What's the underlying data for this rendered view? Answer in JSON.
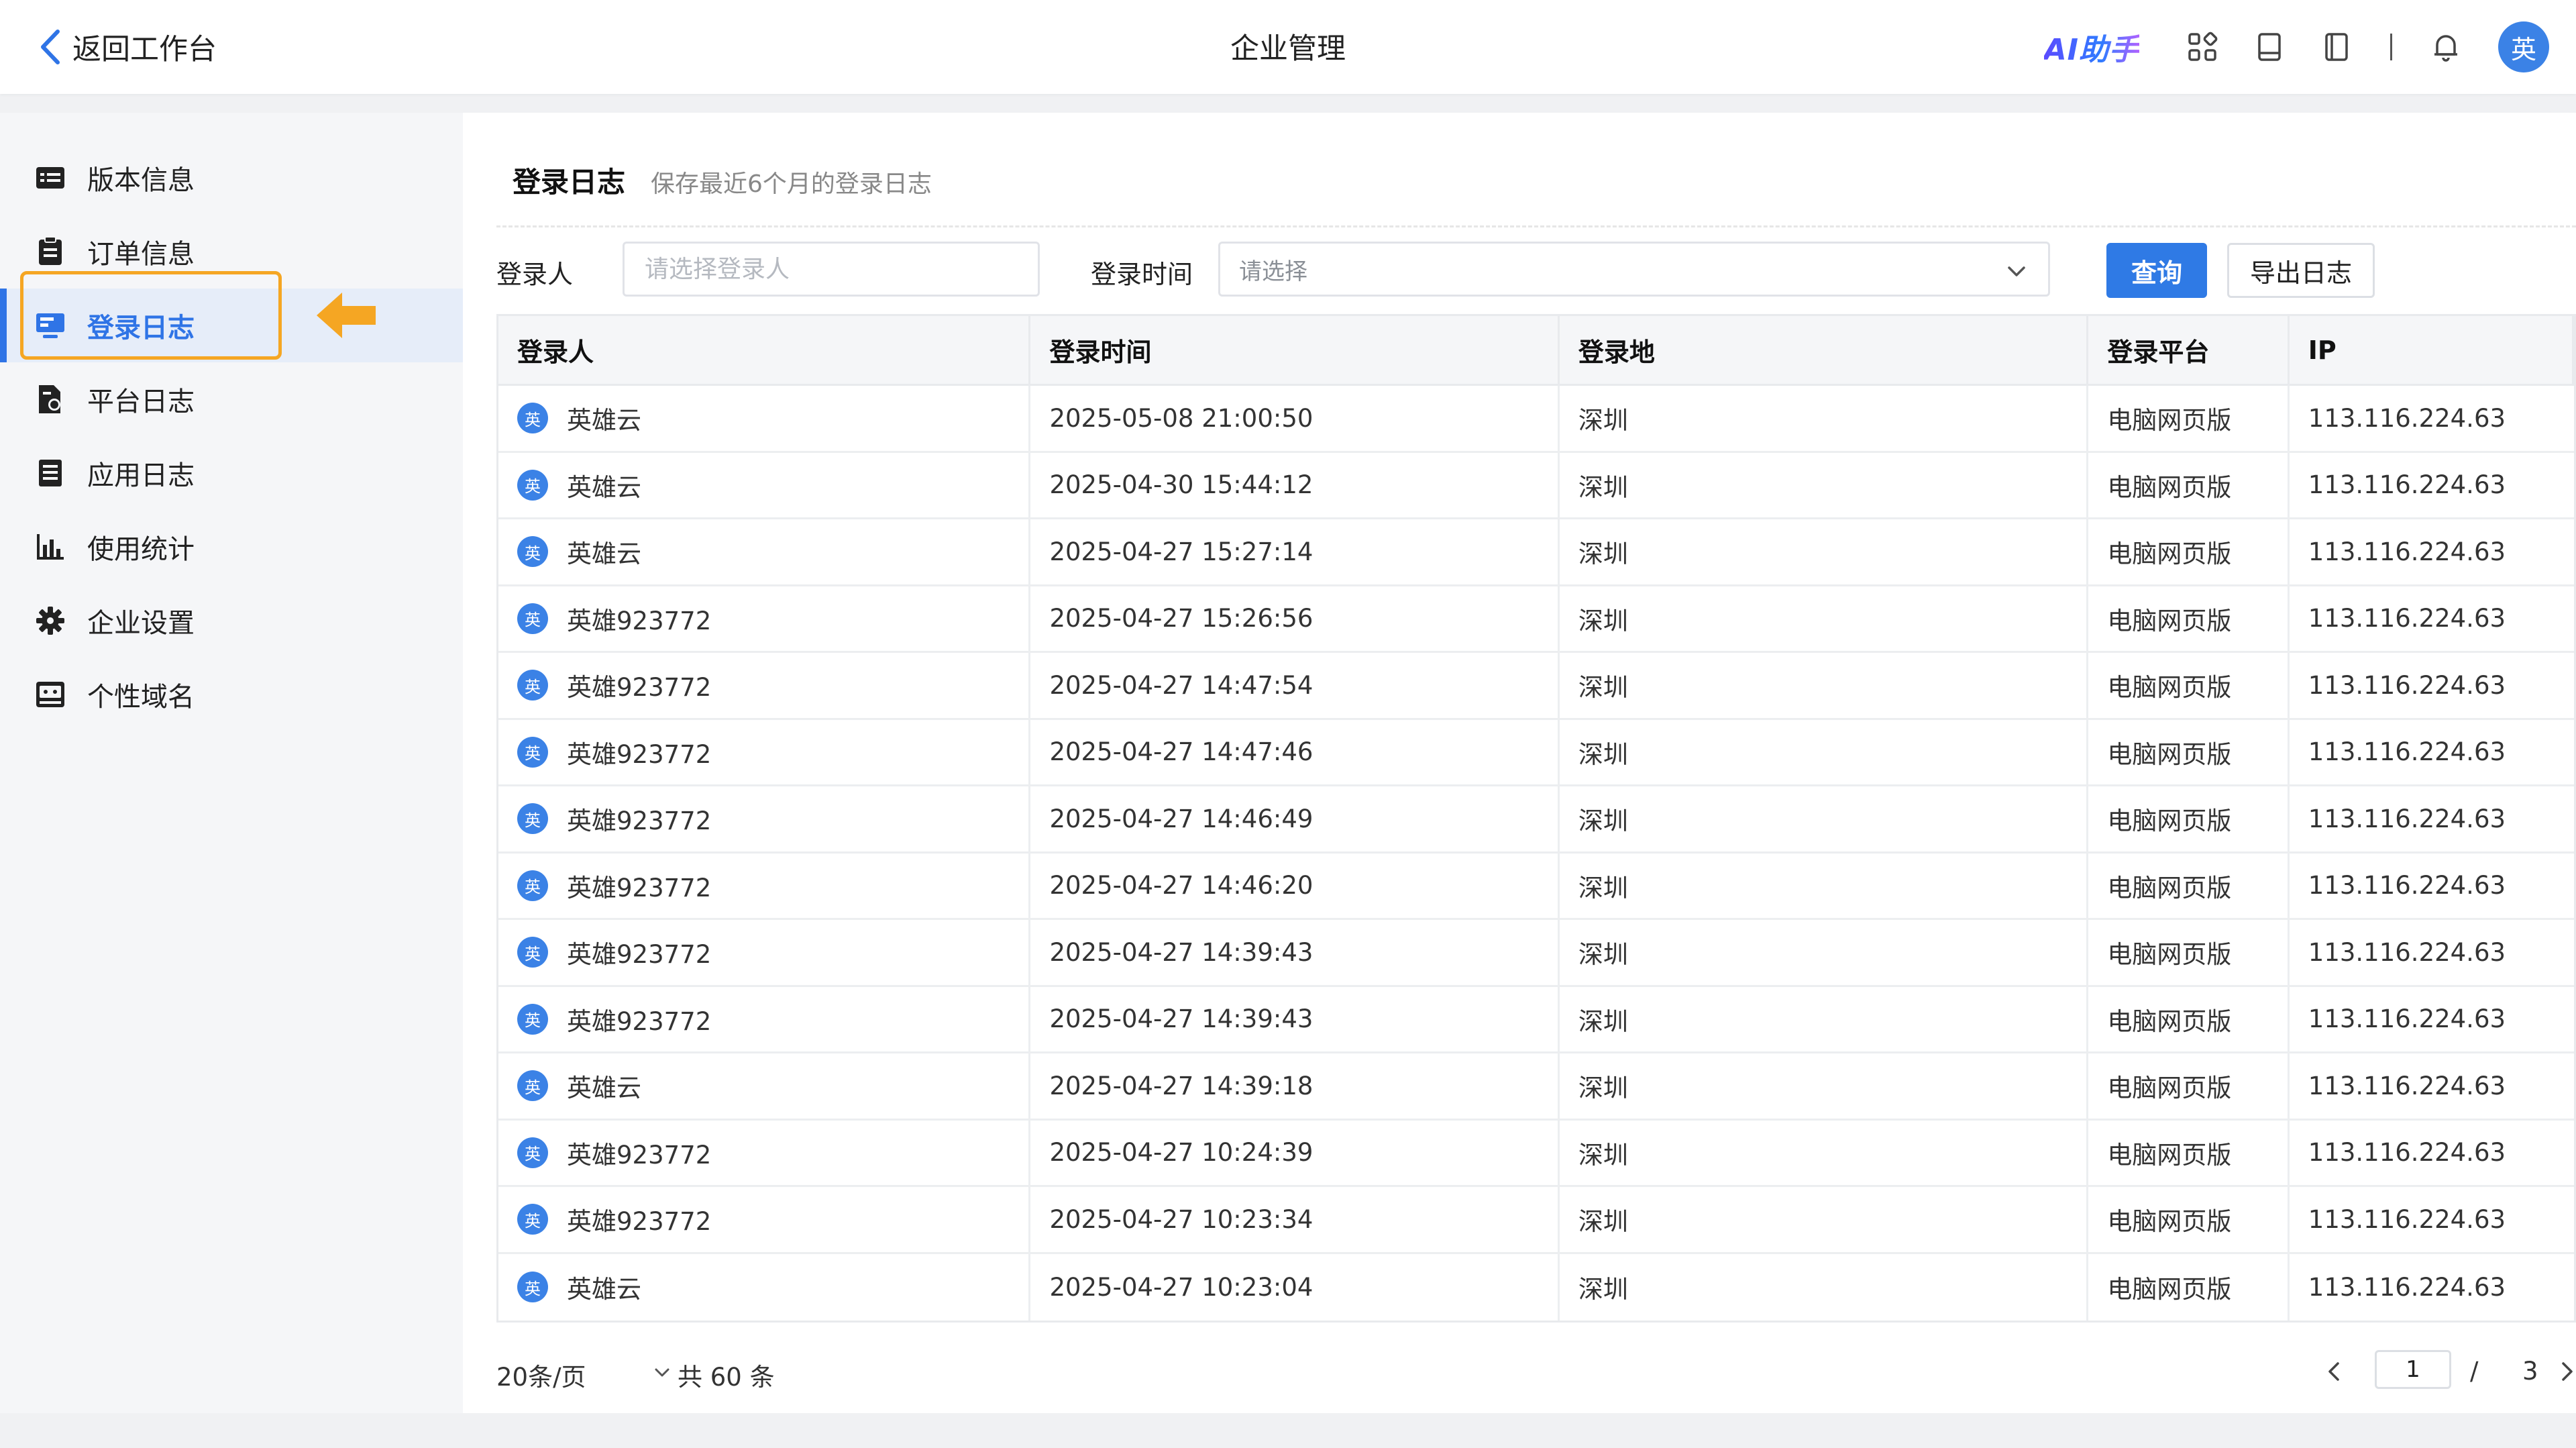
{
  "header": {
    "back_label": "返回工作台",
    "title": "企业管理",
    "ai_label": "AI助手",
    "avatar_text": "英",
    "icons": [
      "apps-icon",
      "book-icon",
      "notebook-icon",
      "bell-icon"
    ]
  },
  "sidebar": {
    "items": [
      {
        "label": "版本信息",
        "icon": "version-icon"
      },
      {
        "label": "订单信息",
        "icon": "order-icon"
      },
      {
        "label": "登录日志",
        "icon": "monitor-icon",
        "active": true
      },
      {
        "label": "平台日志",
        "icon": "platform-log-icon"
      },
      {
        "label": "应用日志",
        "icon": "app-log-icon"
      },
      {
        "label": "使用统计",
        "icon": "bar-chart-icon"
      },
      {
        "label": "企业设置",
        "icon": "gear-icon"
      },
      {
        "label": "个性域名",
        "icon": "domain-icon"
      }
    ],
    "highlight_color": "#f5a623"
  },
  "main": {
    "section_title": "登录日志",
    "section_subtitle": "保存最近6个月的登录日志",
    "filters": {
      "user_label": "登录人",
      "user_placeholder": "请选择登录人",
      "time_label": "登录时间",
      "time_placeholder": "请选择",
      "query_button": "查询",
      "export_button": "导出日志"
    },
    "table": {
      "columns": [
        "登录人",
        "登录时间",
        "登录地",
        "登录平台",
        "IP"
      ],
      "avatar_text": "英",
      "rows": [
        [
          "英雄云",
          "2025-05-08 21:00:50",
          "深圳",
          "电脑网页版",
          "113.116.224.63"
        ],
        [
          "英雄云",
          "2025-04-30 15:44:12",
          "深圳",
          "电脑网页版",
          "113.116.224.63"
        ],
        [
          "英雄云",
          "2025-04-27 15:27:14",
          "深圳",
          "电脑网页版",
          "113.116.224.63"
        ],
        [
          "英雄923772",
          "2025-04-27 15:26:56",
          "深圳",
          "电脑网页版",
          "113.116.224.63"
        ],
        [
          "英雄923772",
          "2025-04-27 14:47:54",
          "深圳",
          "电脑网页版",
          "113.116.224.63"
        ],
        [
          "英雄923772",
          "2025-04-27 14:47:46",
          "深圳",
          "电脑网页版",
          "113.116.224.63"
        ],
        [
          "英雄923772",
          "2025-04-27 14:46:49",
          "深圳",
          "电脑网页版",
          "113.116.224.63"
        ],
        [
          "英雄923772",
          "2025-04-27 14:46:20",
          "深圳",
          "电脑网页版",
          "113.116.224.63"
        ],
        [
          "英雄923772",
          "2025-04-27 14:39:43",
          "深圳",
          "电脑网页版",
          "113.116.224.63"
        ],
        [
          "英雄923772",
          "2025-04-27 14:39:43",
          "深圳",
          "电脑网页版",
          "113.116.224.63"
        ],
        [
          "英雄云",
          "2025-04-27 14:39:18",
          "深圳",
          "电脑网页版",
          "113.116.224.63"
        ],
        [
          "英雄923772",
          "2025-04-27 10:24:39",
          "深圳",
          "电脑网页版",
          "113.116.224.63"
        ],
        [
          "英雄923772",
          "2025-04-27 10:23:34",
          "深圳",
          "电脑网页版",
          "113.116.224.63"
        ],
        [
          "英雄云",
          "2025-04-27 10:23:04",
          "深圳",
          "电脑网页版",
          "113.116.224.63"
        ]
      ]
    },
    "pagination": {
      "page_size": "20条/页",
      "total": "共 60 条",
      "current_page": "1",
      "separator": "/",
      "total_pages": "3"
    }
  },
  "colors": {
    "primary": "#2f7ae5",
    "active_bg": "#e6edf9",
    "avatar": "#3b82e6",
    "annotation": "#f5a623"
  }
}
